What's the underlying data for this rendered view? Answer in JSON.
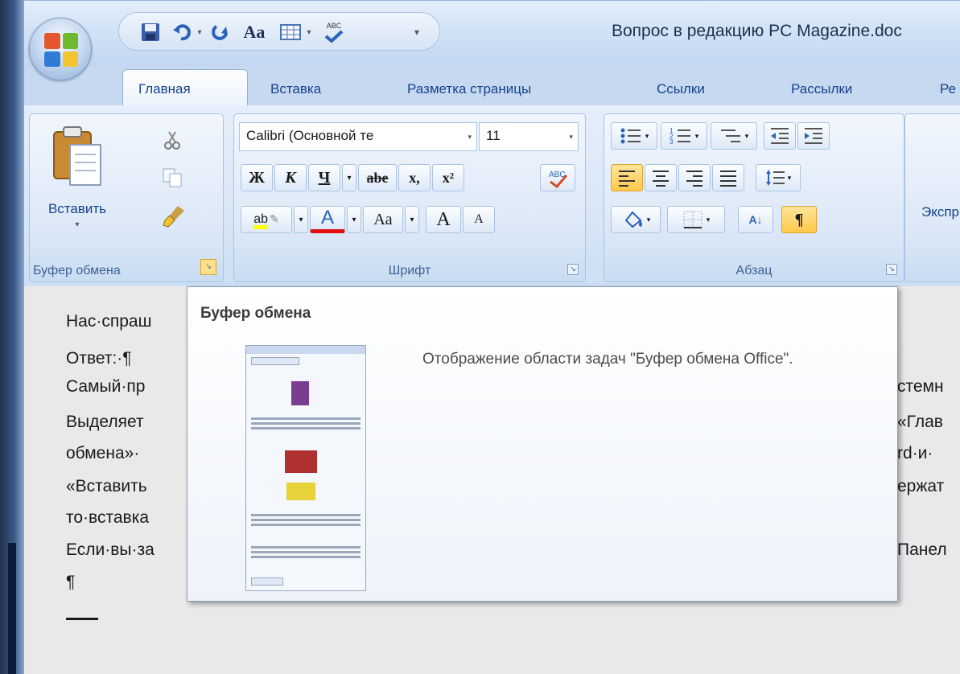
{
  "window": {
    "document_title": "Вопрос в редакцию PC Magazine.doc"
  },
  "qat": {
    "icons": [
      "save-icon",
      "undo-icon",
      "redo-icon",
      "change-case-icon",
      "table-icon",
      "spelling-icon",
      "customize-qat-icon"
    ],
    "font_label": "Aa",
    "spelling_label": "ABC"
  },
  "tabs": [
    {
      "label": "Главная",
      "active": true
    },
    {
      "label": "Вставка",
      "active": false
    },
    {
      "label": "Разметка страницы",
      "active": false
    },
    {
      "label": "Ссылки",
      "active": false
    },
    {
      "label": "Рассылки",
      "active": false
    },
    {
      "label": "Ре",
      "active": false
    }
  ],
  "ribbon": {
    "clipboard": {
      "label": "Буфер обмена",
      "paste_label": "Вставить"
    },
    "font": {
      "label": "Шрифт",
      "font_name": "Calibri (Основной те",
      "font_size": "11",
      "bold": "Ж",
      "italic": "К",
      "underline": "Ч",
      "strike": "abe",
      "subscript": "x,",
      "superscript": "x²",
      "highlight": "ab",
      "font_color": "A",
      "change_case": "Aa",
      "grow": "A",
      "shrink": "A"
    },
    "paragraph": {
      "label": "Абзац",
      "show_marks": "¶",
      "sort": "A↓"
    },
    "next_group_partial": "Экспр"
  },
  "document": {
    "lines_left": [
      "Нас·спраш",
      "Ответ:·¶",
      "Самый·пр",
      "Выделяет",
      "обмена»·",
      "«Вставить",
      "то·вставка",
      "Если·вы·за",
      "¶"
    ],
    "lines_right": [
      "стемн",
      "«Глав",
      "rd·и·",
      "ержат",
      "Панел"
    ]
  },
  "tooltip": {
    "title": "Буфер обмена",
    "description": "Отображение области задач \"Буфер обмена Office\"."
  },
  "colors": {
    "accent": "#15428b",
    "ribbon": "#dce8f7",
    "highlight": "#ffc94c"
  }
}
